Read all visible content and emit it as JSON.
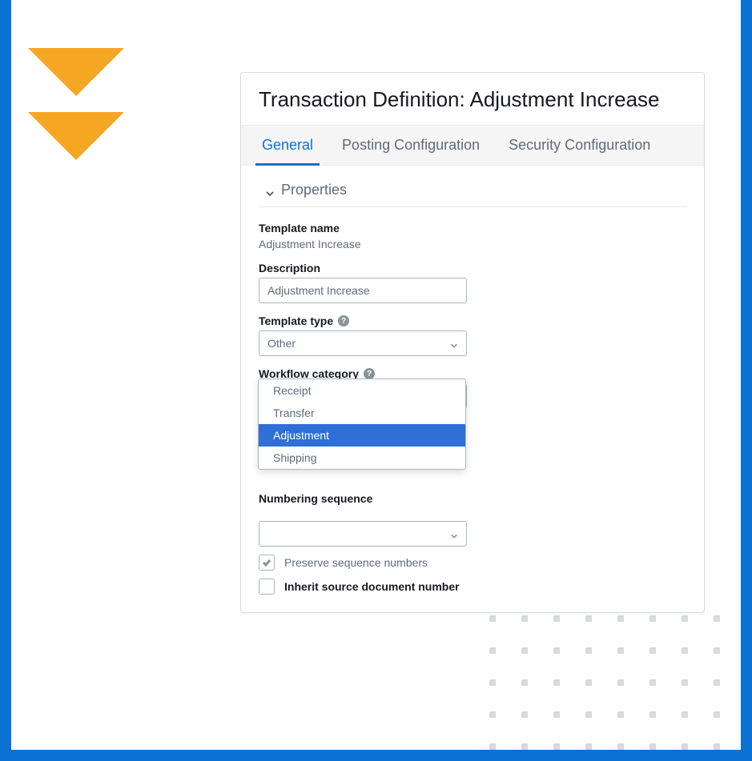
{
  "title": "Transaction Definition: Adjustment Increase",
  "tabs": [
    "General",
    "Posting Configuration",
    "Security Configuration"
  ],
  "section_header": "Properties",
  "fields": {
    "template_name": {
      "label": "Template name",
      "value": "Adjustment Increase"
    },
    "description": {
      "label": "Description",
      "value": "Adjustment Increase"
    },
    "template_type": {
      "label": "Template type",
      "value": "Other"
    },
    "workflow_category": {
      "label": "Workflow category",
      "value": "Adjustment"
    },
    "numbering_sequence": {
      "label": "Numbering sequence",
      "value": ""
    },
    "preserve_sequence": {
      "label": "Preserve sequence numbers",
      "checked": true
    },
    "inherit_source": {
      "label": "Inherit source document number",
      "checked": false
    }
  },
  "dropdown_options": [
    "Receipt",
    "Transfer",
    "Adjustment",
    "Shipping"
  ],
  "help_glyph": "?"
}
